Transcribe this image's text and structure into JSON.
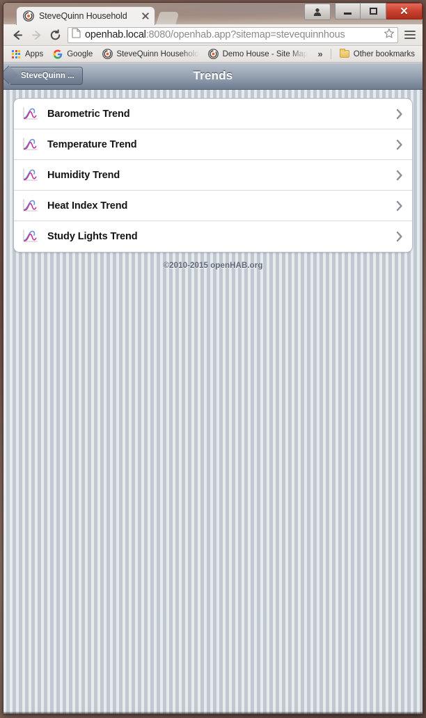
{
  "window": {
    "controls": {
      "user_icon": "user-avatar-icon",
      "minimize_label": "Minimize",
      "maximize_label": "Maximize",
      "close_label": "✕"
    }
  },
  "tab": {
    "title": "SteveQuinn Household",
    "favicon": "openhab-logo-icon",
    "close_icon": "close-icon"
  },
  "toolbar": {
    "back_icon": "arrow-left-icon",
    "forward_icon": "arrow-right-icon",
    "reload_icon": "reload-icon",
    "page_icon": "page-document-icon",
    "star_icon": "bookmark-star-icon",
    "menu_icon": "hamburger-menu-icon",
    "omnibox": {
      "host": "openhab.local",
      "path": ":8080/openhab.app?sitemap=stevequinnhous",
      "full_url": "openhab.local:8080/openhab.app?sitemap=stevequinnhous"
    }
  },
  "bookmarks": {
    "apps_label": "Apps",
    "apps_icon": "apps-grid-icon",
    "items": [
      {
        "label": "Google",
        "icon": "google-g-icon",
        "truncated": false
      },
      {
        "label": "SteveQuinn Household",
        "icon": "openhab-logo-icon",
        "truncated": true
      },
      {
        "label": "Demo House - Site Map",
        "icon": "openhab-logo-icon",
        "truncated": true
      }
    ],
    "overflow_label": "»",
    "other_bookmarks_label": "Other bookmarks",
    "other_bookmarks_icon": "folder-icon"
  },
  "app": {
    "header": {
      "back_label": "SteveQuinn ...",
      "back_icon": "back-arrow-icon",
      "title": "Trends"
    },
    "trends": [
      {
        "label": "Barometric Trend",
        "icon": "chart-thumbnail-icon",
        "chevron": "chevron-right-icon"
      },
      {
        "label": "Temperature Trend",
        "icon": "chart-thumbnail-icon",
        "chevron": "chevron-right-icon"
      },
      {
        "label": "Humidity Trend",
        "icon": "chart-thumbnail-icon",
        "chevron": "chevron-right-icon"
      },
      {
        "label": "Heat Index Trend",
        "icon": "chart-thumbnail-icon",
        "chevron": "chevron-right-icon"
      },
      {
        "label": "Study Lights Trend",
        "icon": "chart-thumbnail-icon",
        "chevron": "chevron-right-icon"
      }
    ],
    "footer": "©2010-2015 openHAB.org"
  },
  "colors": {
    "header_top": "#b9c1cc",
    "header_bottom": "#707e92",
    "page_background": "#ccd2da",
    "row_background": "#ffffff",
    "close_button": "#cc4431",
    "chart_line_blue": "#6b8fd4",
    "chart_line_magenta": "#c2359a"
  }
}
